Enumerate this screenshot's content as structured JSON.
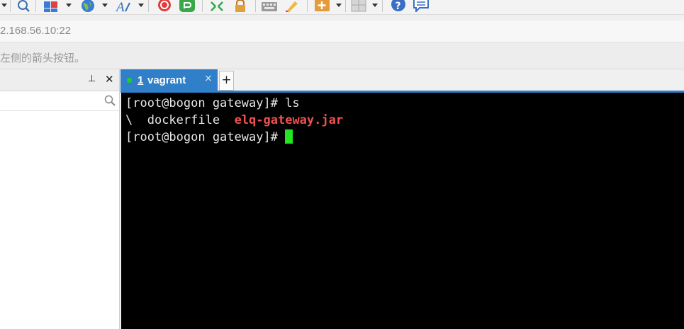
{
  "toolbar": {
    "icons": [
      "search-icon",
      "new-session-icon",
      "globe-icon",
      "font-icon",
      "record-icon",
      "transfer-icon",
      "sync-icon",
      "lock-icon",
      "keyboard-icon",
      "highlight-icon",
      "add-icon",
      "layout-icon",
      "help-icon",
      "chat-icon"
    ]
  },
  "address": {
    "value": "2.168.56.10:22"
  },
  "hint": {
    "text": "左侧的箭头按钮。"
  },
  "left_panel": {
    "pin_glyph": "⊥",
    "close_glyph": "✕",
    "search_placeholder": ""
  },
  "tabs": [
    {
      "number": "1",
      "label": "vagrant",
      "status_color": "#1fd11f",
      "active": true
    }
  ],
  "tab_close_glyph": "×",
  "tab_add_glyph": "+",
  "terminal": {
    "lines": [
      {
        "prompt": "[root@bogon gateway]# ",
        "command": "ls"
      },
      {
        "prefix": "\\  ",
        "file": "dockerfile",
        "spacer": "  ",
        "jar": "elq-gateway.jar"
      },
      {
        "prompt": "[root@bogon gateway]# ",
        "command": ""
      }
    ]
  },
  "colors": {
    "accent": "#2f7fc9",
    "jar_file": "#f05050",
    "cursor": "#22e622"
  }
}
